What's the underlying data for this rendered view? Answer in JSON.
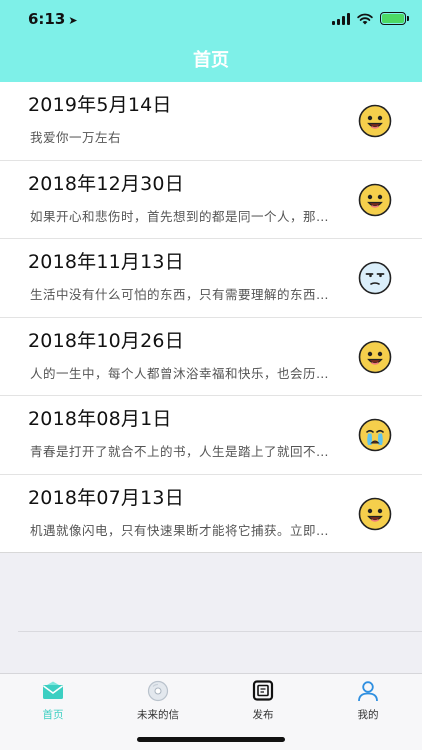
{
  "status_bar": {
    "time": "6:13",
    "location_arrow": "➤"
  },
  "header": {
    "title": "首页"
  },
  "entries": [
    {
      "date": "2019年5月14日",
      "preview": "我爱你一万左右",
      "mood": "happy"
    },
    {
      "date": "2018年12月30日",
      "preview": "如果开心和悲伤时，首先想到的都是同一个人，那…",
      "mood": "happy"
    },
    {
      "date": "2018年11月13日",
      "preview": "生活中没有什么可怕的东西，只有需要理解的东西…",
      "mood": "meh"
    },
    {
      "date": "2018年10月26日",
      "preview": "人的一生中，每个人都曾沐浴幸福和快乐，也会历…",
      "mood": "happy"
    },
    {
      "date": "2018年08月1日",
      "preview": "青春是打开了就合不上的书，人生是踏上了就回不…",
      "mood": "crying"
    },
    {
      "date": "2018年07月13日",
      "preview": "机遇就像闪电，只有快速果断才能将它捕获。立即…",
      "mood": "happy"
    }
  ],
  "tabs": [
    {
      "label": "首页",
      "icon": "mail-icon",
      "active": true
    },
    {
      "label": "未来的信",
      "icon": "disc-icon",
      "active": false
    },
    {
      "label": "发布",
      "icon": "compose-icon",
      "active": false
    },
    {
      "label": "我的",
      "icon": "person-icon",
      "active": false
    }
  ],
  "colors": {
    "header": "#7ef0e8",
    "accent": "#3ccfc2",
    "face": "#f5cf4c"
  }
}
